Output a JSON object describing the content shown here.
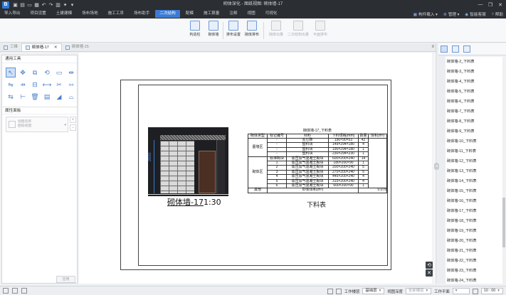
{
  "app": {
    "window_title": "砌体深化 - 图纸视图: 砌体墙-17",
    "quick_access": [
      "save-icon",
      "undo-icon",
      "redo-icon",
      "folder-icon",
      "print-icon",
      "grid-icon",
      "star-icon",
      "more-icon"
    ],
    "window_controls": [
      "—",
      "❐",
      "✕"
    ]
  },
  "menu": {
    "tabs": [
      "导入导出",
      "项目设置",
      "土建建模",
      "场布场地",
      "施工工序",
      "场布助手",
      "二次结构",
      "配模",
      "施工算量",
      "注释",
      "视图",
      "可视化"
    ],
    "active_tab": "二次结构",
    "right": {
      "component_import": "构件载入",
      "manage": "管理",
      "smart_customer_service": "智能客服",
      "help": "帮助"
    }
  },
  "ribbon": {
    "groups": [
      [
        {
          "label": "构造柱",
          "disabled": false
        },
        {
          "label": "砌体墙",
          "disabled": false
        }
      ],
      [
        {
          "label": "排布设置",
          "disabled": false
        },
        {
          "label": "砌体排布",
          "disabled": false
        }
      ],
      [
        {
          "label": "砌体出量",
          "disabled": true
        },
        {
          "label": "二次结构出量",
          "disabled": true
        },
        {
          "label": "平面排布",
          "disabled": true
        }
      ]
    ]
  },
  "doc_tabs": [
    {
      "label": "三维",
      "active": false
    },
    {
      "label": "砌体墙-17",
      "active": true,
      "close": "✕"
    },
    {
      "label": "砌体墙-15",
      "active": false
    }
  ],
  "left_panel": {
    "tools_title": "通用工具",
    "tools": [
      "↖",
      "✥",
      "⧉",
      "⟲",
      "▭",
      "⇹",
      "⇋",
      "⇸",
      "⊟",
      "⟷",
      "✂",
      "⇿",
      "⇆",
      "⊢",
      "🗑",
      "▤",
      "◢",
      "⌓"
    ],
    "properties_title": "属性面板",
    "prop_placeholder_line1": "视图名称",
    "prop_placeholder_line2": "图纸视图",
    "prop_buttons": [
      "+",
      "−"
    ],
    "apply_label": "应用"
  },
  "drawing": {
    "dimension": "2650",
    "view_title_main": "砌体墙-17",
    "view_title_scale": "1:30",
    "table_caption": "下料表",
    "table": {
      "title": "砌体墙-17_下料表",
      "headers": [
        "砌体类型",
        "标记编号",
        "材料",
        "下料规格(mm)",
        "数量",
        "体积(m³)"
      ],
      "rows": [
        [
          "墓墙区",
          "-",
          "实心砖",
          "190×90×53",
          "42",
          ""
        ],
        [
          "",
          "-",
          "塑料块",
          "149×294×180",
          "4",
          ""
        ],
        [
          "",
          "-",
          "塑料块",
          "190×294×180",
          "1",
          ""
        ],
        [
          "",
          "-",
          "塑料块",
          "230×294×230",
          "1",
          ""
        ],
        [
          "",
          "标准砌块",
          "蒸压加气混凝土砌块",
          "600×200×240",
          "14",
          ""
        ],
        [
          "砌体区",
          "1",
          "蒸压加气混凝土砌块",
          "180×200×90",
          "1",
          ""
        ],
        [
          "",
          "2",
          "蒸压加气混凝土砌块",
          "200×200×240",
          "5",
          ""
        ],
        [
          "",
          "3",
          "蒸压加气混凝土砌块",
          "270×200×240",
          "5",
          ""
        ],
        [
          "",
          "4",
          "蒸压加气混凝土砌块",
          "445×200×240",
          "4",
          ""
        ],
        [
          "",
          "5",
          "蒸压加气混凝土砌块",
          "315×200×240",
          "4",
          ""
        ],
        [
          "",
          "6",
          "蒸压加气混凝土砌块",
          "600×200×90",
          "1",
          ""
        ]
      ],
      "other_label": "其他",
      "other_desc": "砂浆体积(m³)",
      "other_value": "0.078"
    }
  },
  "canvas_controls": [
    "⟲",
    "✕"
  ],
  "right_panel": {
    "items": [
      "砌体墙-2_下料表",
      "砌体墙-3_下料表",
      "砌体墙-4_下料表",
      "砌体墙-5_下料表",
      "砌体墙-6_下料表",
      "砌体墙-7_下料表",
      "砌体墙-8_下料表",
      "砌体墙-9_下料表",
      "砌体墙-10_下料表",
      "砌体墙-11_下料表",
      "砌体墙-12_下料表",
      "砌体墙-13_下料表",
      "砌体墙-14_下料表",
      "砌体墙-15_下料表",
      "砌体墙-16_下料表",
      "砌体墙-17_下料表",
      "砌体墙-18_下料表",
      "砌体墙-19_下料表",
      "砌体墙-20_下料表",
      "砌体墙-21_下料表",
      "砌体墙-22_下料表",
      "砌体墙-23_下料表",
      "砌体墙-24_下料表"
    ]
  },
  "status": {
    "work_floor_label": "工作楼层",
    "work_floor_value": "基础层",
    "view_depth_label": "视图深度",
    "view_depth_value": "全部楼层",
    "work_plane_label": "工作平面",
    "scale_value": "10 : 00"
  }
}
